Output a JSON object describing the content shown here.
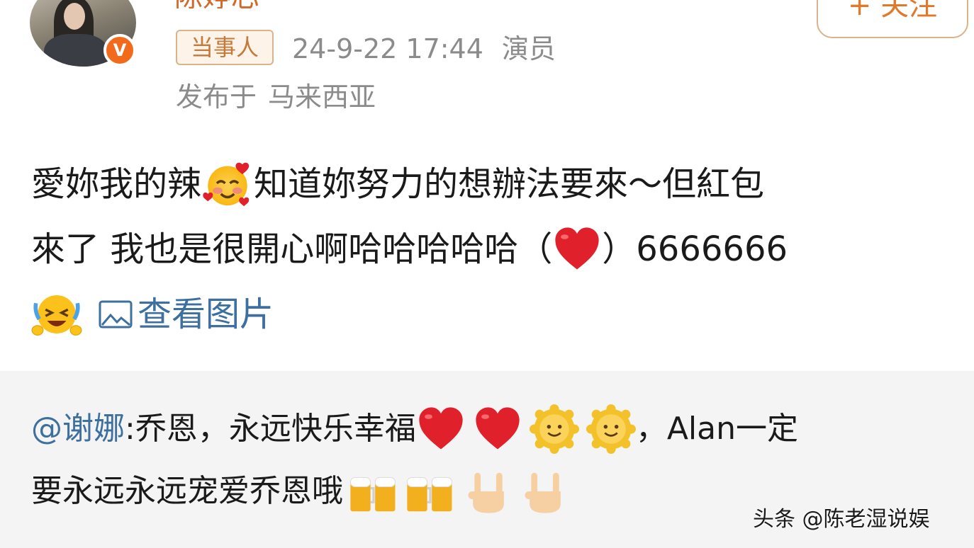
{
  "author": {
    "name_partial": "陈婷芯",
    "verified_badge": "V",
    "follow_label": "+ 关注"
  },
  "post": {
    "tag": "当事人",
    "timestamp": "24-9-22 17:44",
    "role": "演员",
    "location_prefix": "发布于",
    "location": "马来西亚",
    "line1_a": "愛妳我的辣",
    "line1_b": "知道妳努力的想辦法要來～但紅包",
    "line2_a": "來了 我也是很開心啊哈哈哈哈哈（",
    "line2_b": "）6666666",
    "view_pictures": "查看图片",
    "emojis": [
      "smiling-face-with-hearts",
      "red-heart",
      "crying-laughing-hands"
    ]
  },
  "repost": {
    "mention": "@谢娜",
    "text_a": ":乔恩，永远快乐幸福",
    "text_b": "，Alan一定",
    "text_c": "要永远永远宠爱乔恩哦",
    "emojis": [
      "red-heart",
      "red-heart",
      "sun-face",
      "sun-face",
      "beer-mugs",
      "beer-mugs",
      "rock-hand",
      "rock-hand"
    ]
  },
  "watermark": "头条 @陈老湿说娱",
  "colors": {
    "link": "#3d6f9f",
    "accent": "#e07a2a",
    "meta_text": "#8b8b8b",
    "heart": "#e0202a",
    "badge": "#f26a1b"
  }
}
